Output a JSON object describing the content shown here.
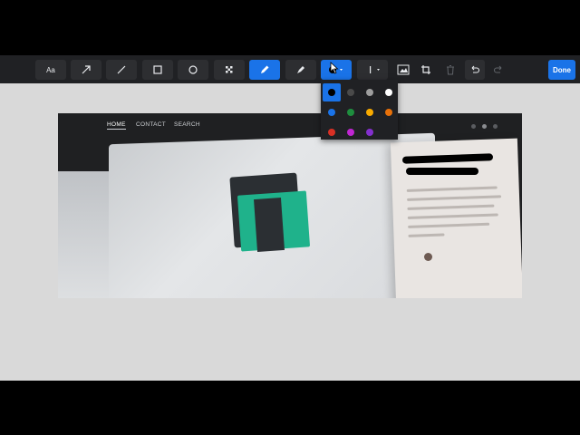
{
  "toolbar": {
    "text_tool_label": "Aa",
    "done_label": "Done",
    "tools": [
      "text",
      "arrow",
      "line",
      "rectangle",
      "ellipse",
      "blur",
      "pen",
      "highlighter",
      "color",
      "line-width",
      "crop-screen",
      "crop",
      "delete",
      "undo",
      "redo"
    ],
    "active_tool": "pen",
    "selected_color": "#000000"
  },
  "palette": {
    "colors": [
      [
        "#000000",
        "#4a4a4a",
        "#9e9e9e",
        "#ffffff"
      ],
      [
        "#1a73e8",
        "#1e8e3e",
        "#f9ab00",
        "#e8710a"
      ],
      [
        "#d93025",
        "#c026d3",
        "#8430ce",
        ""
      ]
    ]
  },
  "screenshot": {
    "nav": {
      "home": "HOME",
      "contact": "CONTACT",
      "search": "SEARCH"
    }
  },
  "colors": {
    "accent": "#1a73e8",
    "toolbar_bg": "#202124",
    "canvas_bg": "#d9d9d9",
    "logo_green": "#1fb28b"
  }
}
